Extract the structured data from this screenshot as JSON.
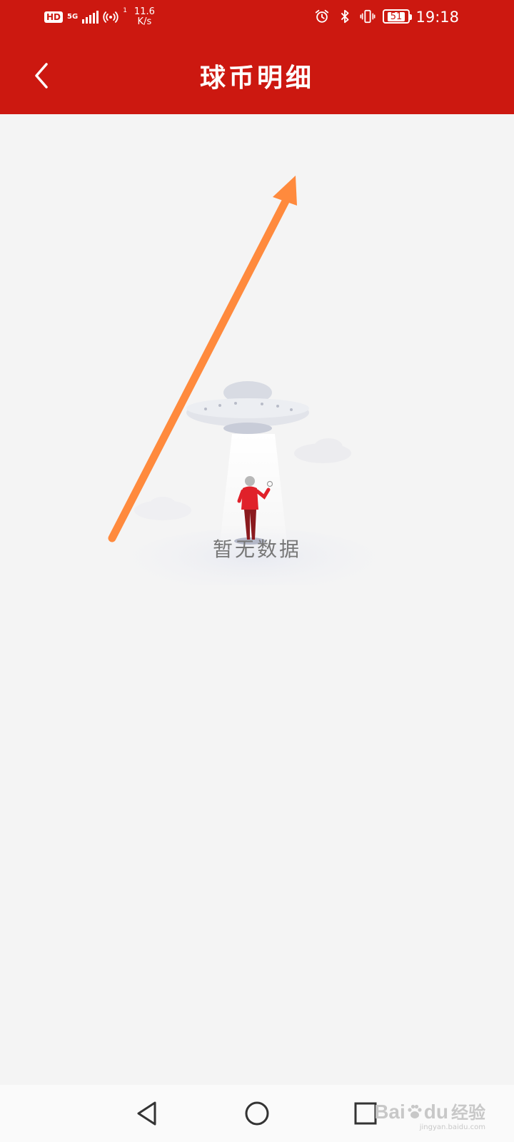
{
  "colors": {
    "brand_red": "#cc1810",
    "background": "#f4f4f4",
    "annotation_orange": "#ff8a3d",
    "empty_text": "#777777"
  },
  "status_bar": {
    "hd": "HD",
    "network": "5G",
    "hotspot_count": "1",
    "speed_value": "11.6",
    "speed_unit": "K/s",
    "battery": "51",
    "time": "19:18",
    "icons": [
      "signal-icon",
      "hotspot-icon",
      "alarm-icon",
      "bluetooth-icon",
      "vibrate-icon",
      "battery-icon"
    ]
  },
  "nav": {
    "title": "球币明细",
    "back_icon": "chevron-left-icon"
  },
  "empty_state": {
    "message": "暂无数据",
    "illustration": "ufo-abduction-illustration"
  },
  "system_nav": {
    "icons": [
      "triangle-back-icon",
      "circle-home-icon",
      "square-recents-icon"
    ]
  },
  "watermark": {
    "main_latin": "Bai",
    "main_latin2": "du",
    "main_cn": "经验",
    "sub": "jingyan.baidu.com"
  }
}
